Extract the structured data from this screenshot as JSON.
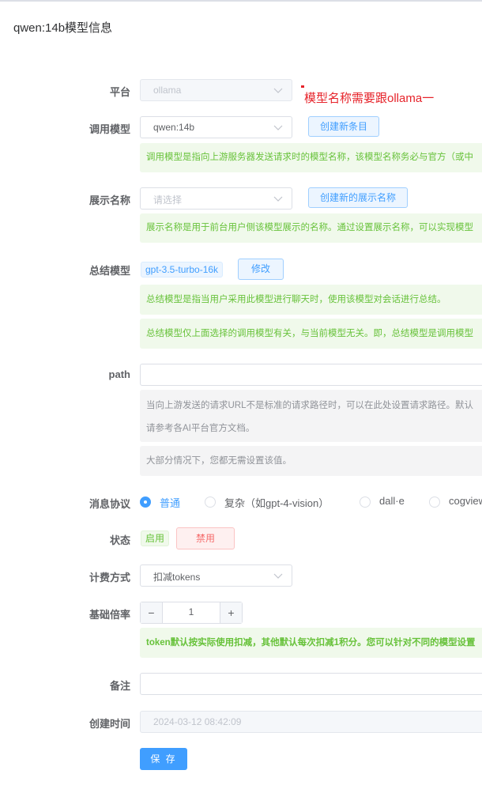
{
  "page": {
    "title": "qwen:14b模型信息"
  },
  "annotation": {
    "text": "模型名称需要跟ollama一"
  },
  "platform": {
    "label": "平台",
    "value": "ollama"
  },
  "model": {
    "label": "调用模型",
    "value": "qwen:14b",
    "create_button": "创建新条目",
    "tip": "调用模型是指向上游服务器发送请求时的模型名称，该模型名称务必与官方（或中"
  },
  "display_name": {
    "label": "展示名称",
    "placeholder": "请选择",
    "create_button": "创建新的展示名称",
    "tip": "展示名称是用于前台用户侧该模型展示的名称。通过设置展示名称，可以实现模型"
  },
  "summary_model": {
    "label": "总结模型",
    "tag": "gpt-3.5-turbo-16k",
    "edit_button": "修改",
    "tip1": "总结模型是指当用户采用此模型进行聊天时，使用该模型对会话进行总结。",
    "tip2": "总结模型仅上面选择的调用模型有关，与当前模型无关。即，总结模型是调用模型"
  },
  "path": {
    "label": "path",
    "value": "",
    "info1_line1": "当向上游发送的请求URL不是标准的请求路径时，可以在此处设置请求路径。默认",
    "info1_line2": "请参考各AI平台官方文档。",
    "info2": "大部分情况下，您都无需设置该值。"
  },
  "protocol": {
    "label": "消息协议",
    "options": [
      "普通",
      "复杂（如gpt-4-vision）",
      "dall·e",
      "cogview"
    ],
    "selected": "普通"
  },
  "status": {
    "label": "状态",
    "tag": "启用",
    "disable_button": "禁用"
  },
  "billing": {
    "label": "计费方式",
    "value": "扣减tokens"
  },
  "rate": {
    "label": "基础倍率",
    "value": "1",
    "dec": "−",
    "inc": "+",
    "tip": "token默认按实际使用扣减，其他默认每次扣减1积分。您可以针对不同的模型设置"
  },
  "remark": {
    "label": "备注",
    "value": ""
  },
  "created": {
    "label": "创建时间",
    "value": "2024-03-12 08:42:09"
  },
  "save_button": "保 存",
  "colors": {
    "primary": "#409eff",
    "success": "#67c23a",
    "danger": "#f56c6c",
    "annotation": "#e6232a"
  }
}
